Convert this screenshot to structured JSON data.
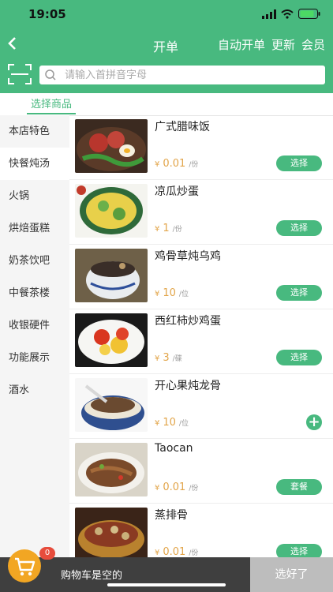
{
  "status": {
    "time": "19:05"
  },
  "nav": {
    "title": "开单",
    "actions": [
      "自动开单",
      "更新",
      "会员"
    ]
  },
  "search": {
    "placeholder": "请输入首拼音字母"
  },
  "tab": "选择商品",
  "categories": [
    "本店特色",
    "快餐炖汤",
    "火锅",
    "烘焙蛋糕",
    "奶茶饮吧",
    "中餐茶楼",
    "收银硬件",
    "功能展示",
    "酒水"
  ],
  "active_category": "快餐炖汤",
  "currency": "¥",
  "items": [
    {
      "name": "广式腊味饭",
      "price": "0.01",
      "unit": "/份",
      "action": "选择"
    },
    {
      "name": "凉瓜炒蛋",
      "price": "1",
      "unit": "/份",
      "action": "选择"
    },
    {
      "name": "鸡骨草炖乌鸡",
      "price": "10",
      "unit": "/位",
      "action": "选择"
    },
    {
      "name": "西红柿炒鸡蛋",
      "price": "3",
      "unit": "/碟",
      "action": "选择"
    },
    {
      "name": "开心果炖龙骨",
      "price": "10",
      "unit": "/位",
      "action": "+"
    },
    {
      "name": "Taocan",
      "price": "0.01",
      "unit": "/份",
      "action": "套餐"
    },
    {
      "name": "蒸排骨",
      "price": "0.01",
      "unit": "/份",
      "action": "选择"
    }
  ],
  "cart": {
    "count": "0",
    "empty_text": "购物车是空的",
    "submit": "选好了"
  },
  "colors": {
    "primary": "#48b97f",
    "price": "#e2a54a",
    "cart": "#f2a623"
  }
}
